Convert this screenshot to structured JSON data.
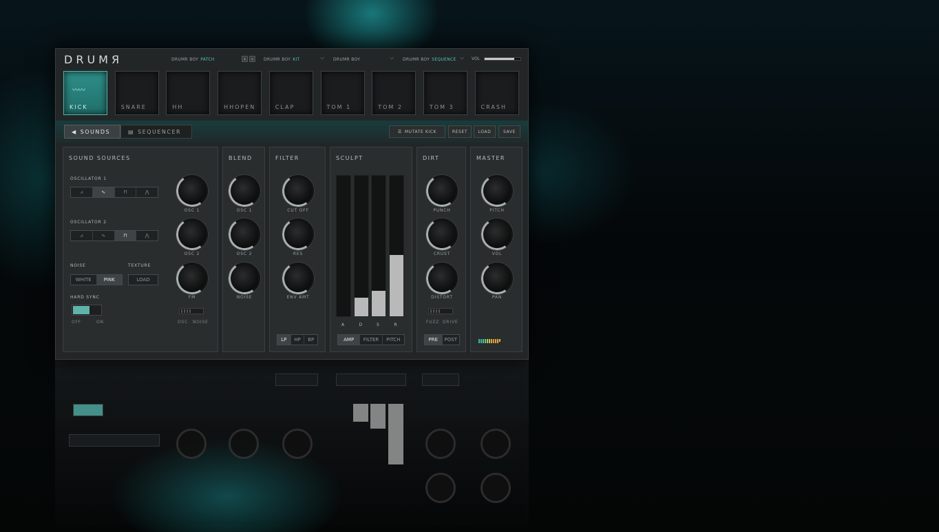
{
  "app": {
    "logo": "DRUMЯ"
  },
  "header": {
    "patch": {
      "prefix": "DRUMR BOY",
      "accent": "PATCH"
    },
    "kit": {
      "prefix": "DRUMR BOY",
      "accent": "KIT"
    },
    "boy": {
      "prefix": "DRUMR BOY",
      "accent": ""
    },
    "sequence": {
      "prefix": "DRUMR BOY",
      "accent": "SEQUENCE"
    },
    "prev_label": "‹",
    "next_label": "›",
    "vol_label": "VOL",
    "vol_level": 0.82
  },
  "pads": [
    {
      "label": "KICK",
      "active": true
    },
    {
      "label": "SNARE",
      "active": false
    },
    {
      "label": "HH",
      "active": false
    },
    {
      "label": "HHOPEN",
      "active": false
    },
    {
      "label": "CLAP",
      "active": false
    },
    {
      "label": "TOM 1",
      "active": false
    },
    {
      "label": "TOM 2",
      "active": false
    },
    {
      "label": "TOM 3",
      "active": false
    },
    {
      "label": "CRASH",
      "active": false
    }
  ],
  "tabs": {
    "sounds": "SOUNDS",
    "sequencer": "SEQUENCER"
  },
  "toolbar": {
    "mutate": "MUTATE KICK",
    "reset": "RESET",
    "load": "LOAD",
    "save": "SAVE"
  },
  "sources": {
    "title": "SOUND SOURCES",
    "osc1_label": "OSCILLATOR 1",
    "osc2_label": "OSCILLATOR 2",
    "noise_label": "NOISE",
    "texture_label": "TEXTURE",
    "white": "WHITE",
    "pink": "PINK",
    "texture_load": "LOAD",
    "hardsync": "HARD SYNC",
    "off": "OFF",
    "on": "ON",
    "knob_osc1": "OSC 1",
    "knob_osc2": "OSC 2",
    "knob_fm": "FM",
    "fm_osc": "OSC",
    "fm_noise": "NOISE"
  },
  "blend": {
    "title": "BLEND",
    "osc1": "OSC 1",
    "osc2": "OSC 2",
    "noise": "NOISE"
  },
  "filter": {
    "title": "FILTER",
    "cutoff": "CUT OFF",
    "res": "RES",
    "env_amt": "ENV AMT",
    "lp": "LP",
    "hp": "HP",
    "bp": "BP"
  },
  "sculpt": {
    "title": "SCULPT",
    "labels": [
      "A",
      "D",
      "S",
      "R"
    ],
    "levels": [
      0.0,
      0.13,
      0.18,
      0.43
    ],
    "amp": "AMP",
    "filter": "FILTER",
    "pitch": "PITCH"
  },
  "dirt": {
    "title": "DIRT",
    "punch": "PUNCH",
    "crust": "CRUST",
    "distort": "DISTORT",
    "fuzz": "FUZZ",
    "drive": "DRIVE",
    "pre": "PRE",
    "post": "POST"
  },
  "master": {
    "title": "MASTER",
    "pitch": "PITCH",
    "vol": "VOL",
    "pan": "PAN"
  },
  "colors": {
    "accent": "#4fc4b8",
    "pad_active": "#2a8580",
    "panel": "#2a2d2e"
  }
}
